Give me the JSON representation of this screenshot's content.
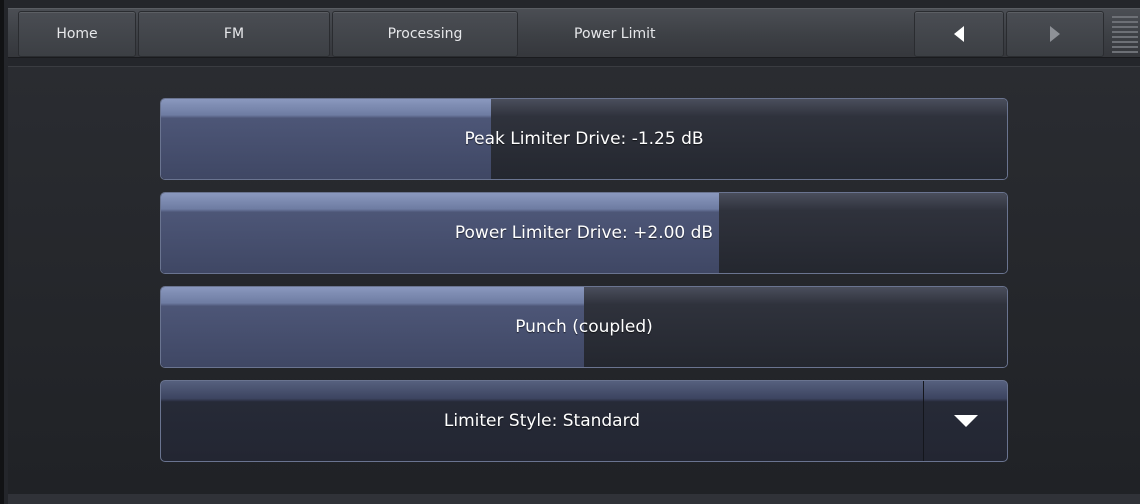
{
  "nav": {
    "home": "Home",
    "fm": "FM",
    "processing": "Processing",
    "title": "Power Limit",
    "prev_icon": "triangle-left-icon",
    "next_icon": "triangle-right-icon",
    "menu_icon": "menu-lines-icon"
  },
  "controls": {
    "peak_limiter_drive": {
      "label": "Peak Limiter Drive: -1.25 dB",
      "fill_fraction": 0.39
    },
    "power_limiter_drive": {
      "label": "Power Limiter Drive: +2.00 dB",
      "fill_fraction": 0.66
    },
    "punch": {
      "label": "Punch (coupled)",
      "fill_fraction": 0.5
    },
    "limiter_style": {
      "label": "Limiter Style: Standard",
      "icon": "dropdown-arrow-icon"
    }
  },
  "colors": {
    "accent": "#6e7ca2",
    "background": "#24262b",
    "text": "#ffffff"
  }
}
